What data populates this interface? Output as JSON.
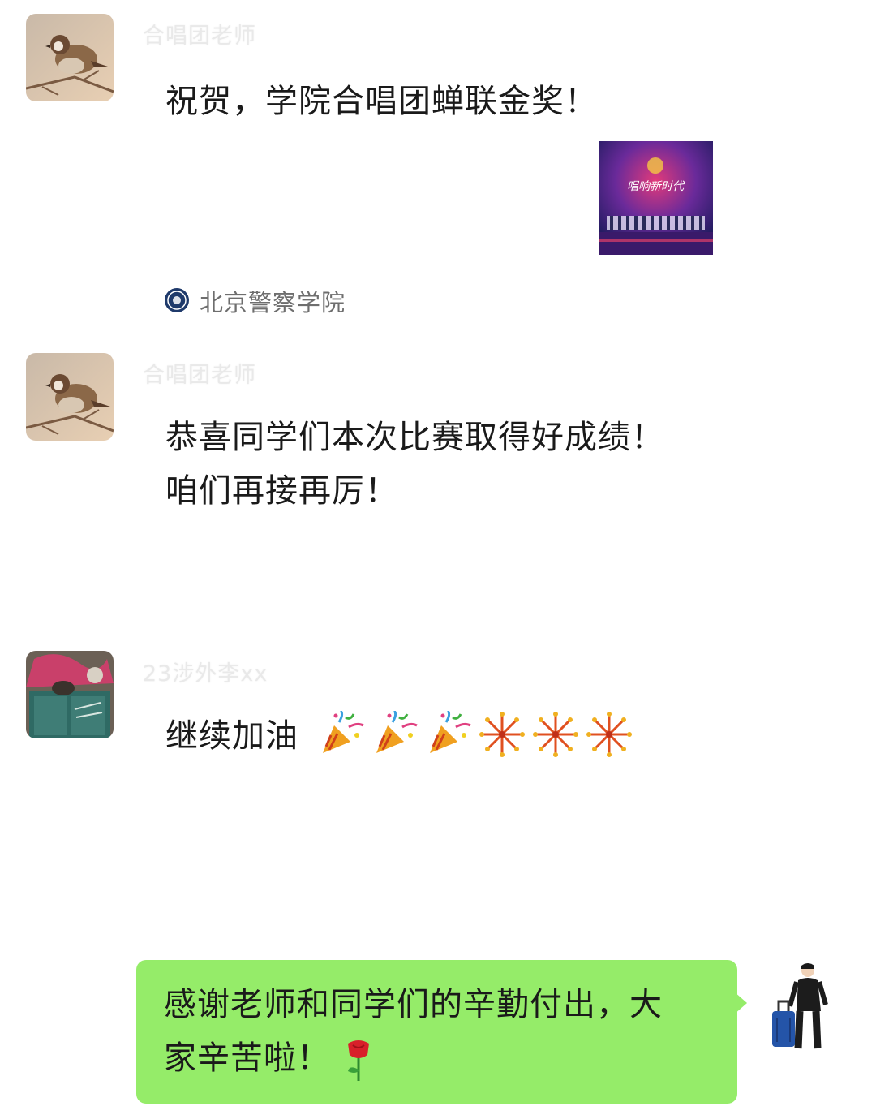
{
  "messages": [
    {
      "sender": "合唱团老师",
      "text": "祝贺，学院合唱团蝉联金奖！",
      "link_card": {
        "thumb_caption": "唱响新时代",
        "source": "北京警察学院"
      }
    },
    {
      "sender": "合唱团老师",
      "lines": [
        "恭喜同学们本次比赛取得好成绩！",
        "咱们再接再厉！"
      ]
    },
    {
      "sender": "23涉外李xx",
      "text": "继续加油",
      "emojis": [
        "party-popper",
        "party-popper",
        "party-popper",
        "fireworks",
        "fireworks",
        "fireworks"
      ]
    }
  ],
  "self_message": {
    "lines": [
      "感谢老师和同学们的辛勤付出，大",
      "家辛苦啦！"
    ],
    "emoji": "rose"
  },
  "colors": {
    "self_bubble": "#95ec69",
    "sender_name": "#e9e9e9",
    "text": "#1a1a1a"
  }
}
